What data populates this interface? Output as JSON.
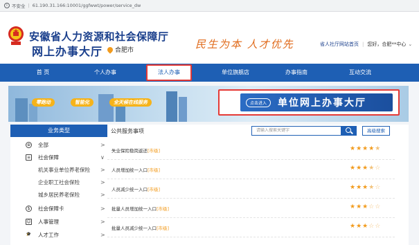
{
  "browser": {
    "security": "不安全",
    "url": "61.190.31.166:10001/ggfwwt/power/service_dw"
  },
  "header": {
    "title": "安徽省人力资源和社会保障厅",
    "subtitle": "网上办事大厅",
    "city": "合肥市",
    "slogan": "民生为本  人才优先",
    "home_link": "省人社厅网站首页",
    "greeting": "您好，合肥**中心"
  },
  "nav": {
    "items": [
      "首 页",
      "个人办事",
      "法人办事",
      "单位旗舰店",
      "办事指南",
      "互动交流"
    ],
    "active": "法人办事"
  },
  "banner": {
    "tags": [
      "零跑动",
      "智能化",
      "全天候在线服务"
    ],
    "enter_button": "点击进入",
    "hall_title": "单位网上办事大厅"
  },
  "sidebar": {
    "header": "业务类型",
    "items": [
      {
        "label": "全部",
        "icon": "globe-icon",
        "level": 1
      },
      {
        "label": "社会保障",
        "icon": "card-icon",
        "level": 1
      },
      {
        "label": "机关事业单位养老保险",
        "level": 2
      },
      {
        "label": "企业职工社会保险",
        "level": 2
      },
      {
        "label": "城乡居民养老保险",
        "level": 2
      },
      {
        "label": "社会保障卡",
        "icon": "ssc-card-icon",
        "level": 1
      },
      {
        "label": "人事管理",
        "icon": "person-icon",
        "level": 1
      },
      {
        "label": "人才工作",
        "icon": "graduation-icon",
        "level": 1
      }
    ]
  },
  "main": {
    "title": "公共服务事项",
    "search_placeholder": "请输入搜索关键字",
    "advanced_search": "高级搜索",
    "services": [
      {
        "name": "失业保险稳岗返还",
        "level": "[市级]",
        "rating": 4.5
      },
      {
        "name": "人员增加统一入口",
        "level": "[市级]",
        "rating": 3.5
      },
      {
        "name": "人员减少统一入口",
        "level": "[市级]",
        "rating": 3.5
      },
      {
        "name": "批量人员增加统一入口",
        "level": "[市级]",
        "rating": 3
      },
      {
        "name": "批量人员减少统一入口",
        "level": "[市级]",
        "rating": 3
      }
    ]
  },
  "colors": {
    "primary": "#1e5fb4",
    "accent": "#f29b1d",
    "highlight": "#e53935"
  }
}
